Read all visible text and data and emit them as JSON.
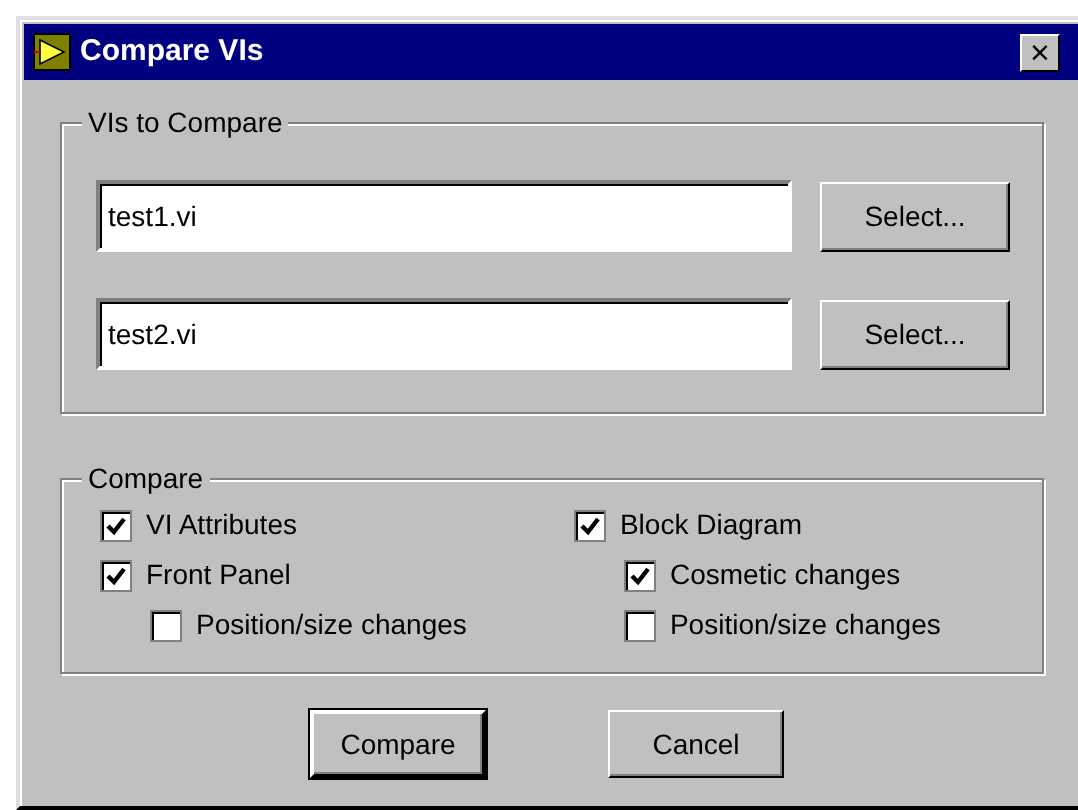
{
  "window": {
    "title": "Compare VIs",
    "close": "×"
  },
  "vis_group": {
    "title": "VIs to Compare",
    "fields": [
      {
        "value": "test1.vi",
        "button": "Select..."
      },
      {
        "value": "test2.vi",
        "button": "Select..."
      }
    ]
  },
  "compare_group": {
    "title": "Compare",
    "columns": [
      [
        {
          "label": "VI Attributes",
          "checked": true
        },
        {
          "label": "Front Panel",
          "checked": true,
          "children": [
            {
              "label": "Position/size changes",
              "checked": false
            }
          ]
        }
      ],
      [
        {
          "label": "Block Diagram",
          "checked": true,
          "children": [
            {
              "label": "Cosmetic changes",
              "checked": true
            },
            {
              "label": "Position/size changes",
              "checked": false
            }
          ]
        }
      ]
    ]
  },
  "buttons": [
    {
      "label": "Compare",
      "default": true
    },
    {
      "label": "Cancel",
      "default": false
    }
  ]
}
